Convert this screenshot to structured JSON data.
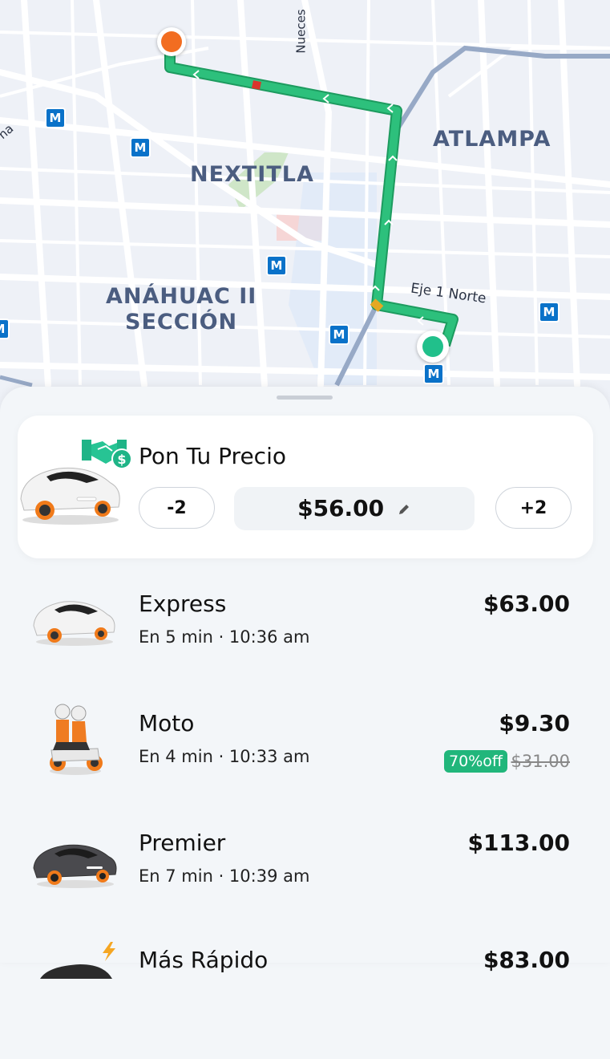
{
  "map": {
    "areas": [
      "NEXTITLA",
      "ATLAMPA",
      "ANÁHUAC II",
      "SECCIÓN"
    ],
    "streets": [
      "Nueces",
      "Eje 1 Norte",
      "na"
    ],
    "metro_icon": "M",
    "colors": {
      "route": "#22b573",
      "origin": "#21c08b",
      "destination": "#f26d21",
      "metro": "#0a72c9"
    }
  },
  "price_offer": {
    "title": "Pon Tu Precio",
    "decrease_label": "-2",
    "increase_label": "+2",
    "price": "$56.00",
    "icons": [
      "handshake-money-icon",
      "pencil-icon",
      "car-icon"
    ]
  },
  "rides": [
    {
      "name": "Express",
      "eta": "En 5 min · 10:36 am",
      "price": "$63.00"
    },
    {
      "name": "Moto",
      "eta": "En 4 min · 10:33 am",
      "price": "$9.30",
      "discount": "70%off",
      "old_price": "$31.00"
    },
    {
      "name": "Premier",
      "eta": "En 7 min · 10:39 am",
      "price": "$113.00"
    },
    {
      "name": "Más Rápido",
      "price": "$83.00",
      "icon": "lightning-icon"
    }
  ]
}
